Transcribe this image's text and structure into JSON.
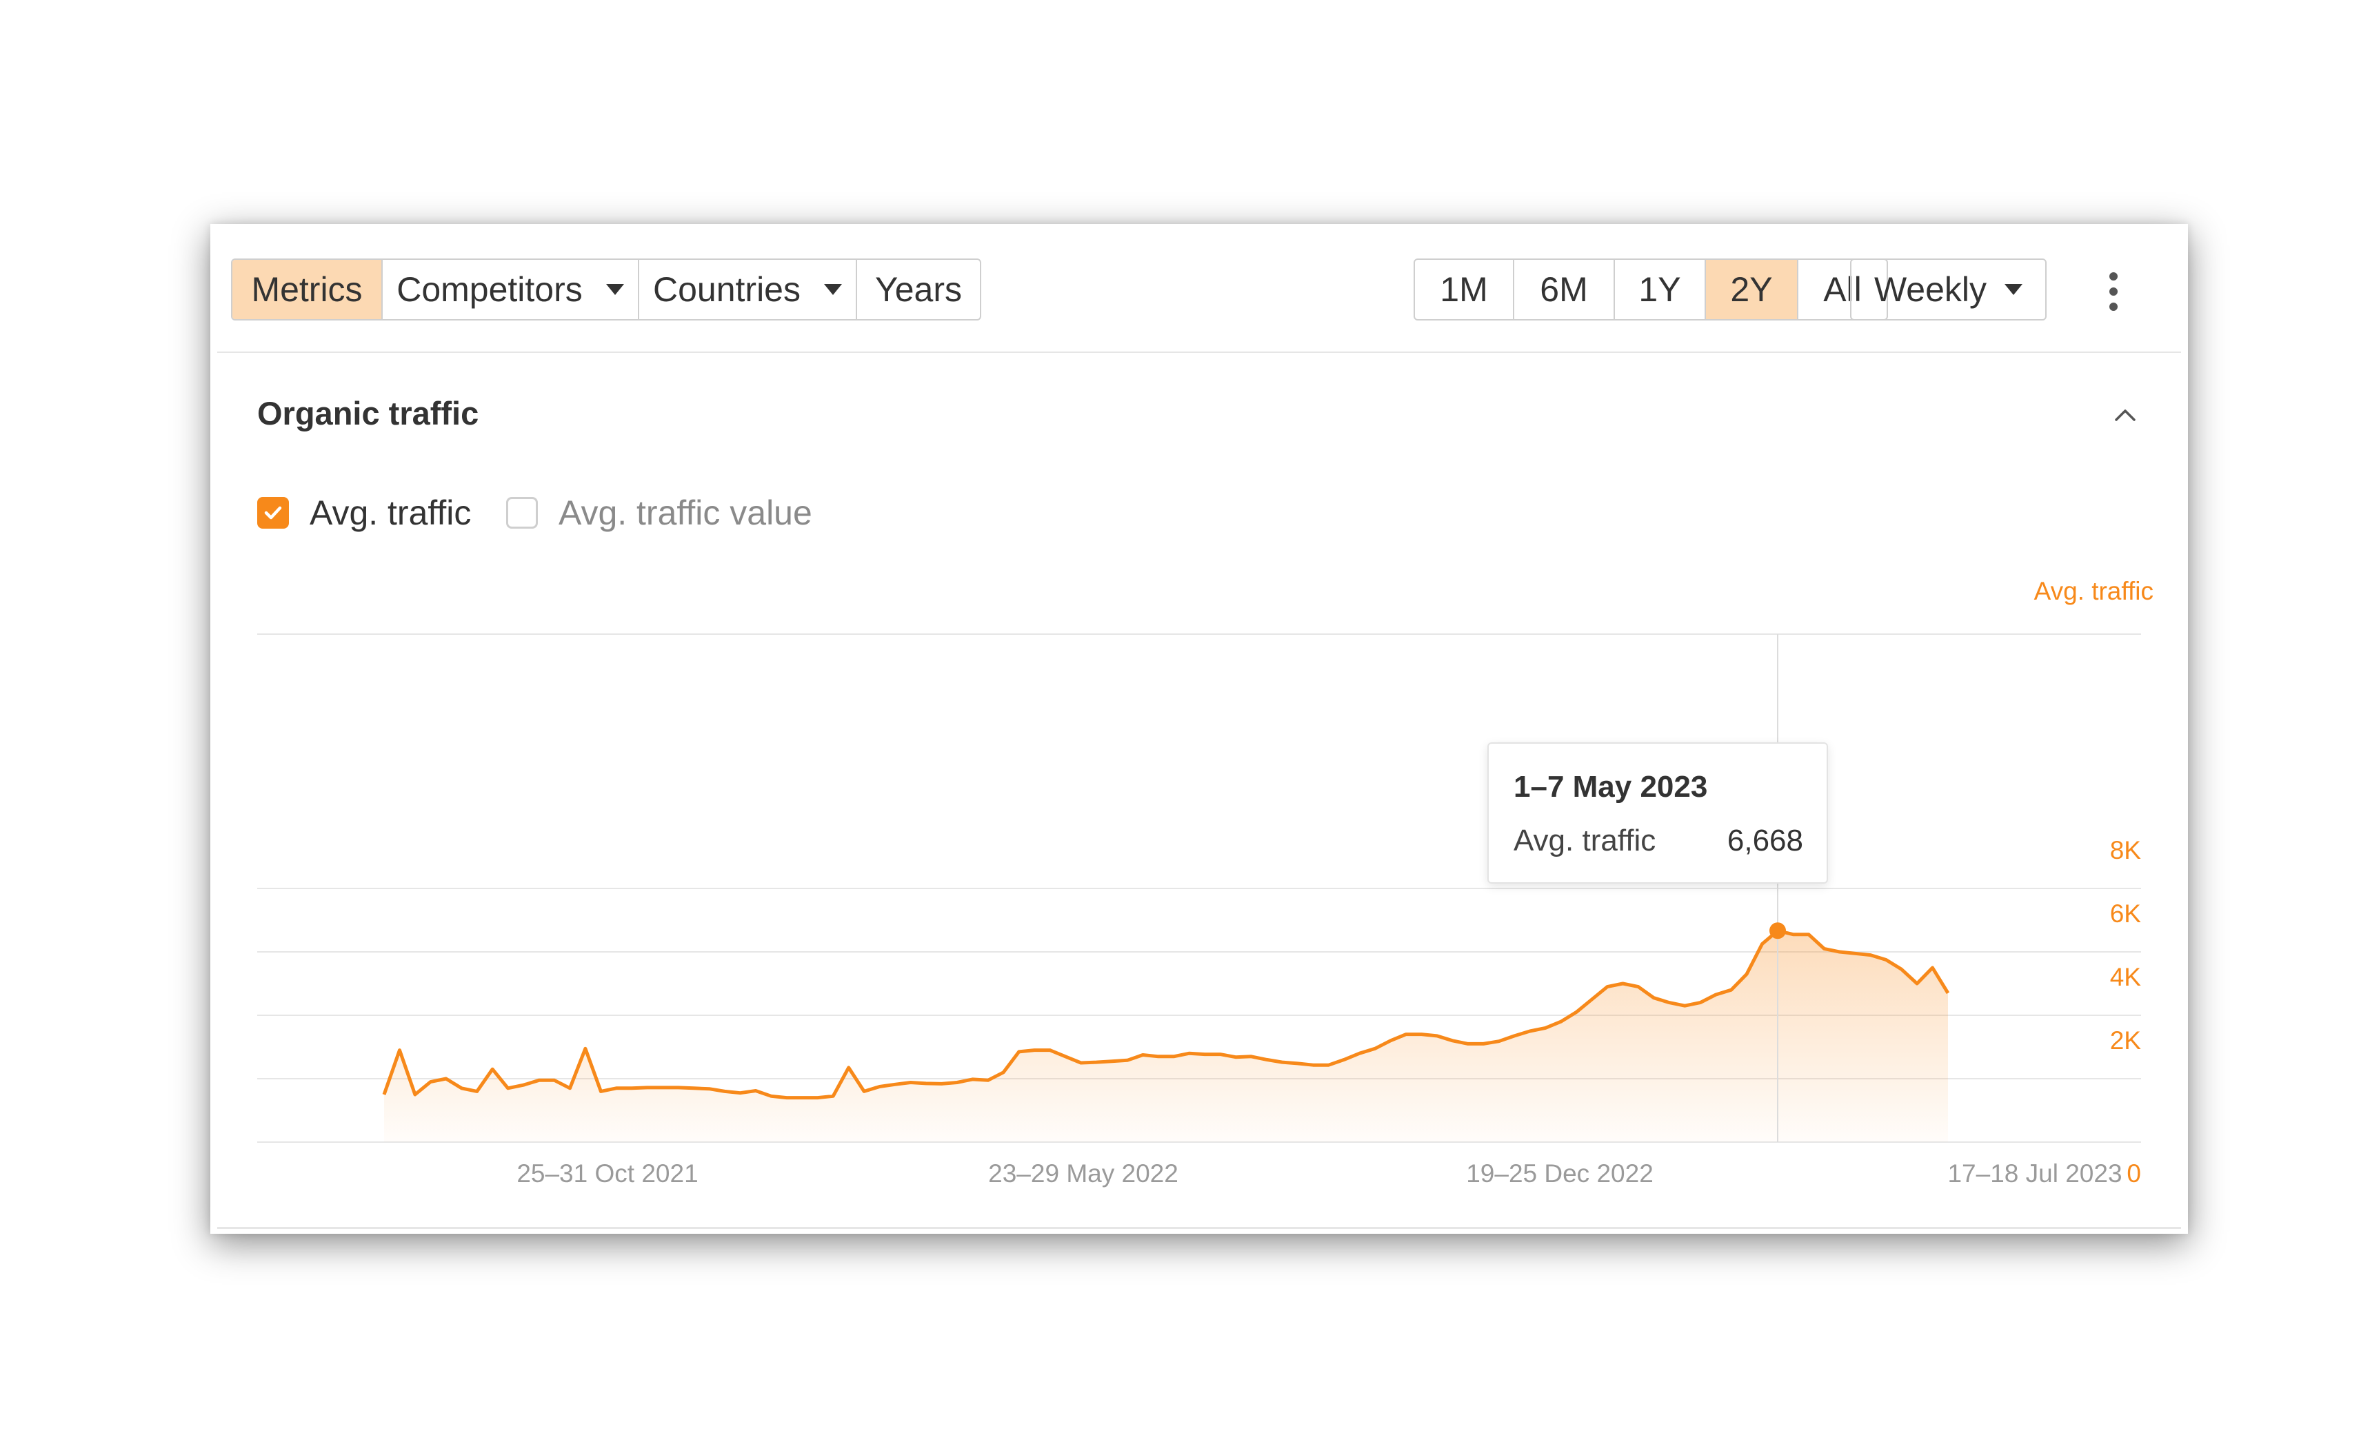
{
  "toolbar": {
    "left_tabs": [
      {
        "label": "Metrics",
        "active": true,
        "has_caret": false
      },
      {
        "label": "Competitors",
        "active": false,
        "has_caret": true
      },
      {
        "label": "Countries",
        "active": false,
        "has_caret": true
      },
      {
        "label": "Years",
        "active": false,
        "has_caret": false
      }
    ],
    "ranges": [
      {
        "label": "1M",
        "active": false
      },
      {
        "label": "6M",
        "active": false
      },
      {
        "label": "1Y",
        "active": false
      },
      {
        "label": "2Y",
        "active": true
      },
      {
        "label": "All",
        "active": false
      }
    ],
    "interval": "Weekly",
    "more_icon": "more-vertical-icon"
  },
  "section": {
    "title": "Organic traffic",
    "collapse_icon": "chevron-up-icon"
  },
  "legend": {
    "items": [
      {
        "label": "Avg. traffic",
        "checked": true
      },
      {
        "label": "Avg. traffic value",
        "checked": false
      }
    ]
  },
  "colors": {
    "accent": "#f7891a",
    "active_tab": "#fcd9b3",
    "grid": "#e6e6e6",
    "axis_text": "#9a9a9a"
  },
  "tooltip": {
    "date": "1–7 May 2023",
    "metric": "Avg. traffic",
    "value": "6,668"
  },
  "chart_data": {
    "type": "area",
    "y_axis_title": "Avg. traffic",
    "x_tick_labels": [
      "25–31 Oct 2021",
      "23–29 May 2022",
      "19–25 Dec 2022",
      "17–18 Jul 2023"
    ],
    "y_tick_labels": [
      "0",
      "2K",
      "4K",
      "6K",
      "8K"
    ],
    "ylim": [
      0,
      8000
    ],
    "grid": true,
    "series": [
      {
        "values": [
          1500,
          2900,
          1500,
          1900,
          2000,
          1700,
          1600,
          2300,
          1700,
          1800,
          1950,
          1950,
          1700,
          2950,
          1600,
          1700,
          1700,
          1720,
          1720,
          1720,
          1700,
          1680,
          1600,
          1550,
          1620,
          1450,
          1400,
          1400,
          1400,
          1450,
          2350,
          1600,
          1750,
          1820,
          1880,
          1850,
          1840,
          1880,
          1980,
          1950,
          2200,
          2850,
          2900,
          2900,
          2700,
          2500,
          2520,
          2550,
          2580,
          2750,
          2700,
          2700,
          2800,
          2770,
          2770,
          2680,
          2700,
          2600,
          2520,
          2480,
          2430,
          2430,
          2600,
          2800,
          2950,
          3200,
          3400,
          3400,
          3350,
          3200,
          3100,
          3100,
          3180,
          3350,
          3500,
          3600,
          3800,
          4100,
          4500,
          4900,
          5000,
          4900,
          4550,
          4400,
          4300,
          4400,
          4650,
          4800,
          5300,
          6250,
          6668,
          6550,
          6550,
          6100,
          6000,
          5950,
          5900,
          5750,
          5450,
          5000,
          5500,
          4700
        ]
      }
    ],
    "highlight": {
      "x_label": "1–7 May 2023",
      "value": 6668
    }
  }
}
